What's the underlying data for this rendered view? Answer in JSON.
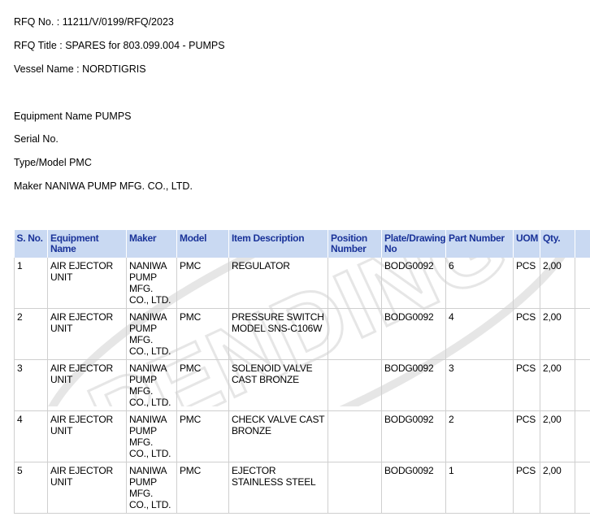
{
  "header": {
    "rfq_no": "RFQ No. : 11211/V/0199/RFQ/2023",
    "rfq_title": "RFQ Title : SPARES for 803.099.004 - PUMPS",
    "vessel_name": "Vessel Name : NORDTIGRIS",
    "equipment_name": "Equipment Name PUMPS",
    "serial_no": "Serial No.",
    "type_model": "Type/Model PMC",
    "maker": "Maker NANIWA PUMP MFG. CO., LTD."
  },
  "table": {
    "columns": [
      "S. No.",
      "Equipment Name",
      "Maker",
      "Model",
      "Item Description",
      "Position Number",
      "Plate/Drawing No",
      "Part Number",
      "UOM",
      "Qty.",
      ""
    ],
    "rows": [
      [
        "1",
        "AIR EJECTOR UNIT",
        "NANIWA PUMP MFG. CO., LTD.",
        "PMC",
        "REGULATOR",
        "",
        "BODG0092",
        "6",
        "PCS",
        "2,00",
        ""
      ],
      [
        "2",
        "AIR EJECTOR UNIT",
        "NANIWA PUMP MFG. CO., LTD.",
        "PMC",
        "PRESSURE SWITCH MODEL SNS-C106W",
        "",
        "BODG0092",
        "4",
        "PCS",
        "2,00",
        ""
      ],
      [
        "3",
        "AIR EJECTOR UNIT",
        "NANIWA PUMP MFG. CO., LTD.",
        "PMC",
        "SOLENOID VALVE CAST BRONZE",
        "",
        "BODG0092",
        "3",
        "PCS",
        "2,00",
        ""
      ],
      [
        "4",
        "AIR EJECTOR UNIT",
        "NANIWA PUMP MFG. CO., LTD.",
        "PMC",
        "CHECK VALVE CAST BRONZE",
        "",
        "BODG0092",
        "2",
        "PCS",
        "2,00",
        ""
      ],
      [
        "5",
        "AIR EJECTOR UNIT",
        "NANIWA PUMP MFG. CO., LTD.",
        "PMC",
        "EJECTOR STAINLESS STEEL",
        "",
        "BODG0092",
        "1",
        "PCS",
        "2,00",
        ""
      ]
    ]
  },
  "watermark": {
    "text": "PENDING",
    "color": "#e6e6e6"
  },
  "colors": {
    "header_bg": "#c9d9f2",
    "header_text": "#1a3399"
  }
}
